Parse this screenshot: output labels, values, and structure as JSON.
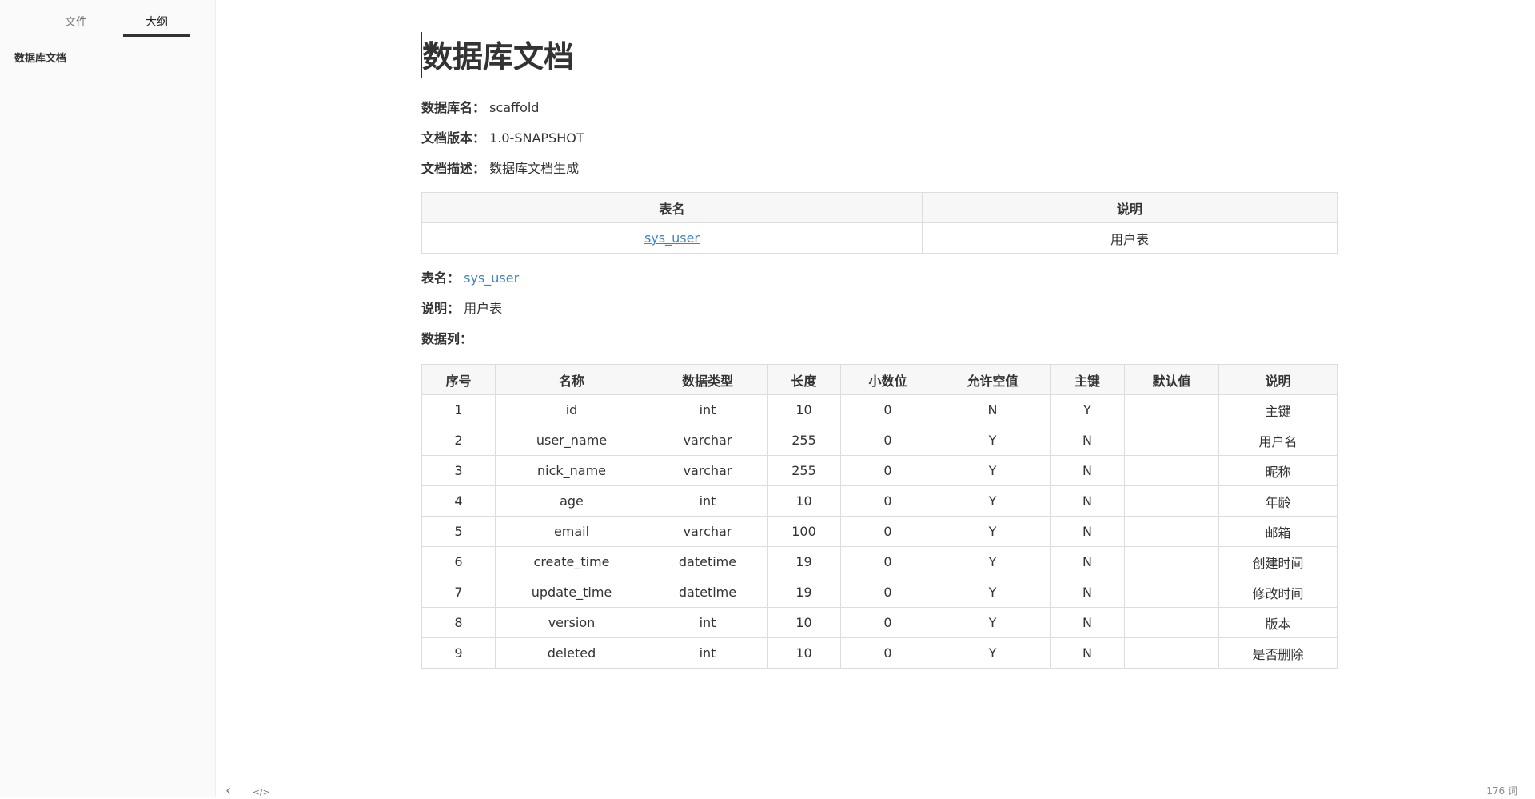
{
  "sidebar": {
    "tabs": [
      "文件",
      "大纲"
    ],
    "outline": [
      "数据库文档"
    ]
  },
  "doc": {
    "title": "数据库文档",
    "meta": [
      {
        "label": "数据库名：",
        "value": "scaffold"
      },
      {
        "label": "文档版本：",
        "value": "1.0-SNAPSHOT"
      },
      {
        "label": "文档描述：",
        "value": "数据库文档生成"
      }
    ],
    "tables_header": [
      "表名",
      "说明"
    ],
    "tables": [
      {
        "name": "sys_user",
        "desc": "用户表"
      }
    ],
    "table_name_label": "表名：",
    "table_name": "sys_user",
    "desc_label": "说明：",
    "desc": "用户表",
    "columns_label": "数据列：",
    "columns_header": [
      "序号",
      "名称",
      "数据类型",
      "长度",
      "小数位",
      "允许空值",
      "主键",
      "默认值",
      "说明"
    ],
    "columns": [
      [
        "1",
        "id",
        "int",
        "10",
        "0",
        "N",
        "Y",
        "",
        "主键"
      ],
      [
        "2",
        "user_name",
        "varchar",
        "255",
        "0",
        "Y",
        "N",
        "",
        "用户名"
      ],
      [
        "3",
        "nick_name",
        "varchar",
        "255",
        "0",
        "Y",
        "N",
        "",
        "昵称"
      ],
      [
        "4",
        "age",
        "int",
        "10",
        "0",
        "Y",
        "N",
        "",
        "年龄"
      ],
      [
        "5",
        "email",
        "varchar",
        "100",
        "0",
        "Y",
        "N",
        "",
        "邮箱"
      ],
      [
        "6",
        "create_time",
        "datetime",
        "19",
        "0",
        "Y",
        "N",
        "",
        "创建时间"
      ],
      [
        "7",
        "update_time",
        "datetime",
        "19",
        "0",
        "Y",
        "N",
        "",
        "修改时间"
      ],
      [
        "8",
        "version",
        "int",
        "10",
        "0",
        "Y",
        "N",
        "",
        "版本"
      ],
      [
        "9",
        "deleted",
        "int",
        "10",
        "0",
        "Y",
        "N",
        "",
        "是否删除"
      ]
    ]
  },
  "footer": {
    "back": "‹",
    "source": "</>",
    "word_count": "176 词"
  }
}
